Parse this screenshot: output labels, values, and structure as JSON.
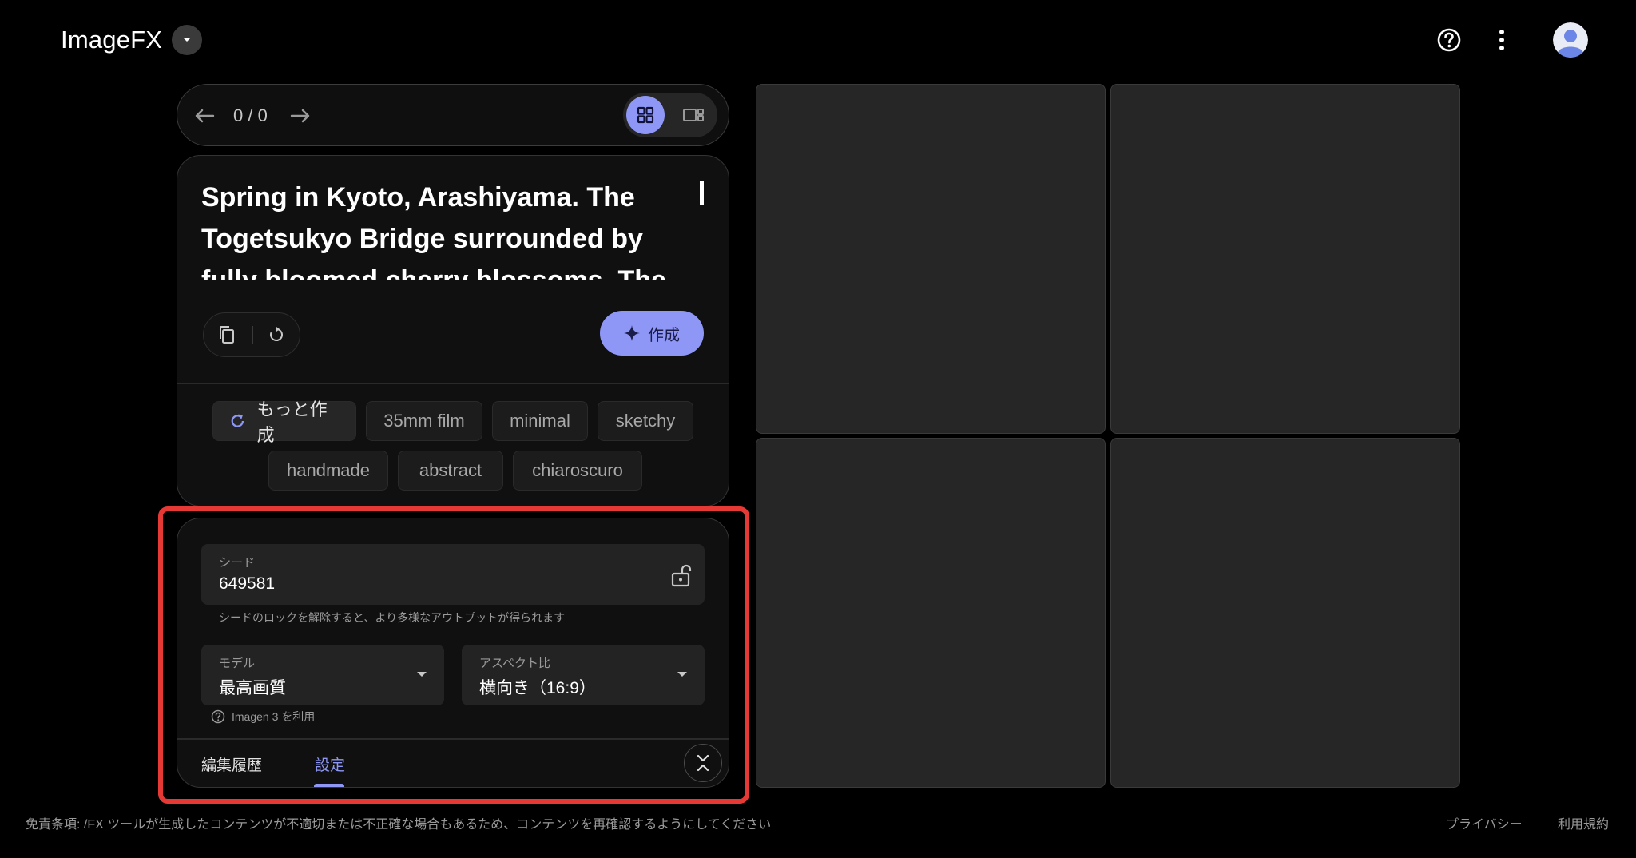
{
  "header": {
    "brand": "ImageFX",
    "help_icon": "help-circle-icon",
    "menu_icon": "more-vertical-icon",
    "avatar_icon": "account-avatar-icon"
  },
  "navigation": {
    "counter": "0 / 0",
    "prev_icon": "arrow-left-icon",
    "next_icon": "arrow-right-icon",
    "view_grid_icon": "grid-view-icon",
    "view_single_icon": "single-view-icon",
    "active_view": "grid"
  },
  "prompt": {
    "text": "Spring in Kyoto, Arashiyama. The Togetsukyo Bridge surrounded by fully bloomed cherry blossoms. The"
  },
  "prompt_tools": {
    "copy_icon": "copy-icon",
    "reset_icon": "reset-icon",
    "create_label": "作成",
    "create_icon": "sparkle-icon"
  },
  "chips": {
    "more_label": "もっと作成",
    "more_icon": "refresh-icon",
    "items": [
      "35mm film",
      "minimal",
      "sketchy",
      "handmade",
      "abstract",
      "chiaroscuro"
    ]
  },
  "settings": {
    "seed_label": "シード",
    "seed_value": "649581",
    "seed_lock_icon": "unlock-icon",
    "seed_helper": "シードのロックを解除すると、より多様なアウトプットが得られます",
    "model_label": "モデル",
    "model_value": "最高画質",
    "aspect_label": "アスペクト比",
    "aspect_value": "横向き（16:9）",
    "model_info": "Imagen 3 を利用",
    "tabs": [
      "編集履歴",
      "設定"
    ],
    "active_tab": "設定",
    "collapse_icon": "collapse-icon"
  },
  "footer": {
    "disclaimer": "免責条項: /FX ツールが生成したコンテンツが不適切または不正確な場合もあるため、コンテンツを再確認するようにしてください",
    "privacy": "プライバシー",
    "terms": "利用規約"
  },
  "colors": {
    "background": "#000000",
    "card": "#101010",
    "accent": "#8e97f5",
    "highlight": "#e53935",
    "tile": "#262626"
  }
}
